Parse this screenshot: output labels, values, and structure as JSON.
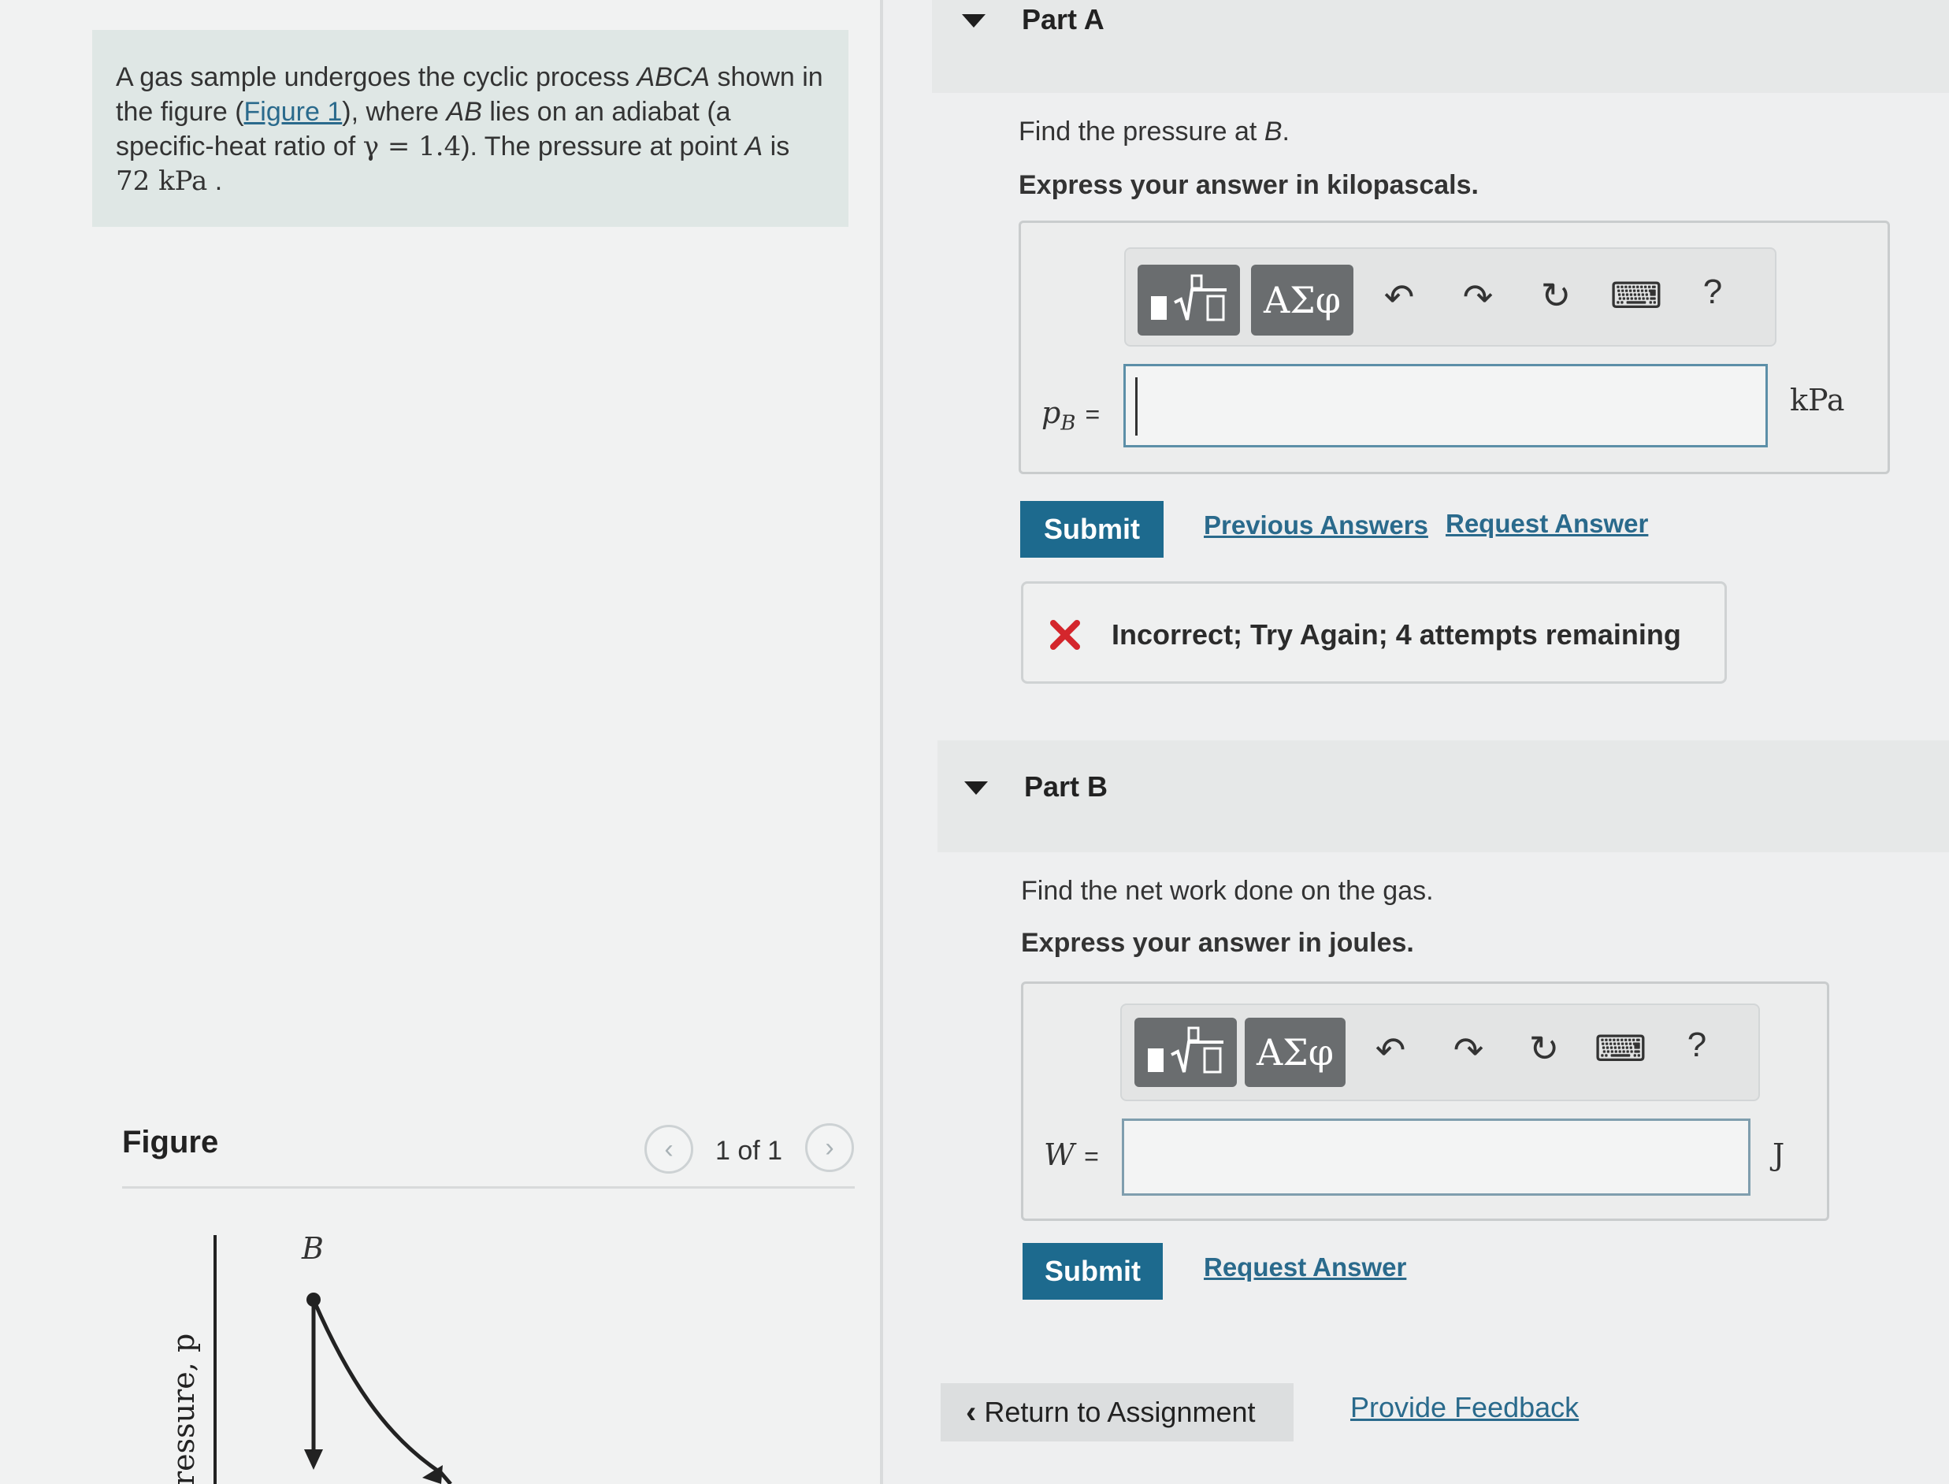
{
  "problem": {
    "seg1": "A gas sample undergoes the cyclic process ",
    "cycle": "ABCA",
    "seg2": " shown in the figure (",
    "figure_link": "Figure 1",
    "seg3": "), where ",
    "ab": "AB",
    "seg4": " lies on an adiabat (a specific-heat ratio of ",
    "gamma_expr": "γ = 1.4",
    "seg5": "). The pressure at point ",
    "point_a": "A",
    "seg6": " is ",
    "pressure_value": "72 kPa",
    "seg7": " ."
  },
  "figure": {
    "title": "Figure",
    "pager_text": "1 of 1",
    "prev_icon": "chevron-left-icon",
    "next_icon": "chevron-right-icon",
    "point_label": "B",
    "axis_label": "ressure, p"
  },
  "partA": {
    "title": "Part A",
    "question_prefix": "Find the pressure at ",
    "question_var": "B",
    "question_suffix": ".",
    "instruction": "Express your answer in kilopascals.",
    "toolbar": {
      "template_icon": "templates-icon",
      "greek": "ΑΣφ",
      "undo": "↶",
      "redo": "↷",
      "reset": "↻",
      "keyboard": "⌨",
      "help": "?"
    },
    "label": "p",
    "label_sub": "B",
    "eq": "=",
    "unit": "kPa",
    "submit": "Submit",
    "previous_answers": "Previous Answers",
    "request_answer": "Request Answer",
    "feedback_text": "Incorrect; Try Again; 4 attempts remaining"
  },
  "partB": {
    "title": "Part B",
    "question": "Find the net work done on the gas.",
    "instruction": "Express your answer in joules.",
    "toolbar": {
      "greek": "ΑΣφ",
      "undo": "↶",
      "redo": "↷",
      "reset": "↻",
      "keyboard": "⌨",
      "help": "?"
    },
    "label": "W",
    "eq": "=",
    "unit": "J",
    "submit": "Submit",
    "request_answer": "Request Answer"
  },
  "footer": {
    "return": "Return to Assignment",
    "provide_feedback": "Provide Feedback"
  },
  "colors": {
    "accent": "#1d6a8e",
    "link": "#2a6a8c",
    "error": "#d4262c",
    "problem_bg": "#dfe7e5"
  }
}
